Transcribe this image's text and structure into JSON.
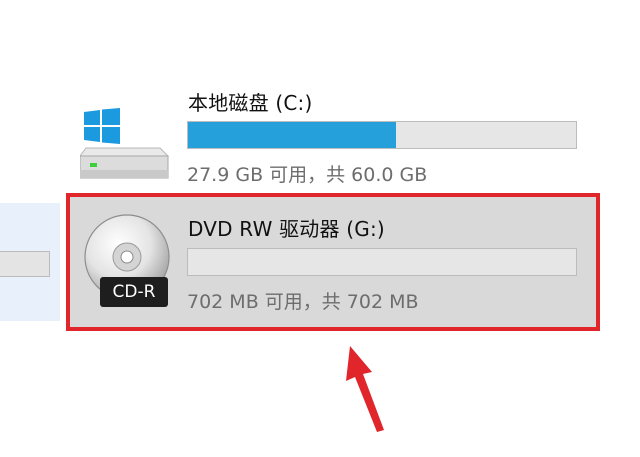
{
  "drives": [
    {
      "id": "c",
      "title": "本地磁盘 (C:)",
      "usage_text": "27.9 GB 可用，共 60.0 GB",
      "used_fraction": 0.535,
      "icon": "windows-hard-drive-icon",
      "selected": false
    },
    {
      "id": "g",
      "title": "DVD RW 驱动器 (G:)",
      "usage_text": "702 MB 可用，共 702 MB",
      "used_fraction": 0.0,
      "icon": "cd-r-disc-icon",
      "badge": "CD-R",
      "selected": true
    }
  ],
  "colors": {
    "bar_fill": "#26a0da",
    "bar_track": "#e6e6e6",
    "selected_bg": "#d9d9d9",
    "annotation_red": "#e0262b"
  }
}
